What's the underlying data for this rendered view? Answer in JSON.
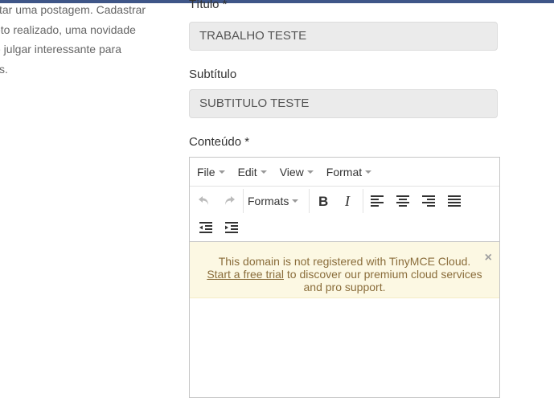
{
  "sidebar_text": {
    "line1": "ztar uma postagem. Cadastrar",
    "line2": "eto realizado, uma novidade",
    "line3": "e julgar interessante para",
    "line4": "s."
  },
  "form": {
    "titulo_label": "Título *",
    "titulo_value": "TRABALHO TESTE",
    "subtitulo_label": "Subtítulo",
    "subtitulo_value": "SUBTITULO TESTE",
    "conteudo_label": "Conteúdo *"
  },
  "editor": {
    "menu": [
      "File",
      "Edit",
      "View",
      "Format"
    ],
    "formats_label": "Formats",
    "notice": {
      "line1": "This domain is not registered with TinyMCE Cloud.",
      "link": "Start a free trial",
      "line2_rest": " to discover our premium cloud services",
      "line3": "and pro support.",
      "close": "×"
    }
  },
  "colors": {
    "topbar": "#3f5688",
    "notice_bg": "#fcf8e3",
    "notice_text": "#8a6d3b",
    "input_bg": "#ebebeb"
  }
}
